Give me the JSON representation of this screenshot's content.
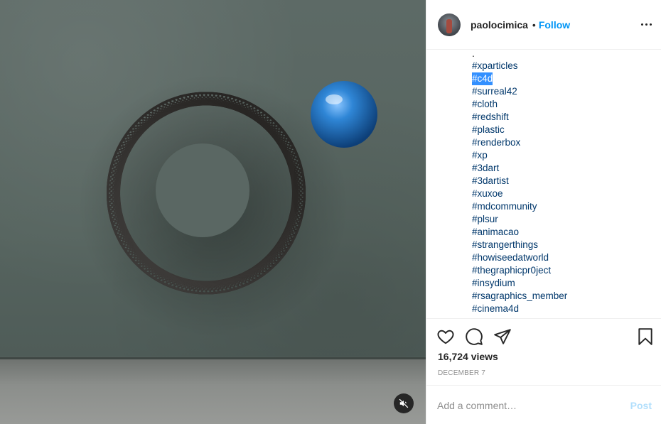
{
  "post": {
    "username": "paolocimica",
    "separator": "•",
    "follow_label": "Follow",
    "more_icon": "more-horizontal-icon",
    "media": {
      "mute_icon": "speaker-muted-icon",
      "ball_color": "#2f86d6",
      "coil_color": "#3b3a38"
    },
    "caption": {
      "lead": ".",
      "hashtags": [
        "#xparticles",
        "#c4d",
        "#surreal42",
        "#cloth",
        "#redshift",
        "#plastic",
        "#renderbox",
        "#xp",
        "#3dart",
        "#3dartist",
        "#xuxoe",
        "#mdcommunity",
        "#plsur",
        "#animacao",
        "#strangerthings",
        "#howiseedatworld",
        "#thegraphicpr0ject",
        "#insydium",
        "#rsagraphics_member",
        "#cinema4d"
      ],
      "selected_hashtag": "#c4d"
    },
    "actions": {
      "like_icon": "heart-icon",
      "comment_icon": "comment-bubble-icon",
      "share_icon": "paper-plane-icon",
      "save_icon": "bookmark-icon"
    },
    "views": "16,724 views",
    "date": "DECEMBER 7",
    "comment": {
      "placeholder": "Add a comment…",
      "post_label": "Post"
    }
  }
}
